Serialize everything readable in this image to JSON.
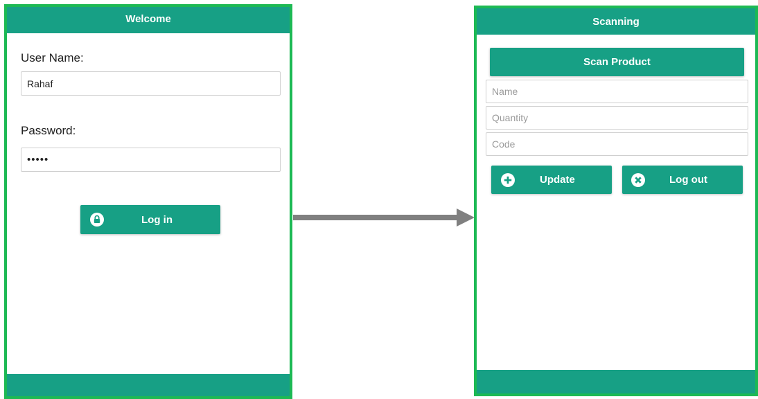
{
  "login_screen": {
    "header": {
      "title": "Welcome"
    },
    "username": {
      "label": "User Name:",
      "value": "Rahaf"
    },
    "password": {
      "label": "Password:",
      "value": "•••••"
    },
    "login_button": {
      "label": "Log in",
      "icon": "lock-icon"
    }
  },
  "scan_screen": {
    "header": {
      "title": "Scanning"
    },
    "scan_button": {
      "label": "Scan Product"
    },
    "fields": {
      "name_placeholder": "Name",
      "quantity_placeholder": "Quantity",
      "code_placeholder": "Code"
    },
    "update_button": {
      "label": "Update",
      "icon": "plus-icon"
    },
    "logout_button": {
      "label": "Log out",
      "icon": "close-icon"
    }
  },
  "colors": {
    "accent": "#17a085",
    "frame": "#1db954",
    "arrow": "#808080"
  }
}
